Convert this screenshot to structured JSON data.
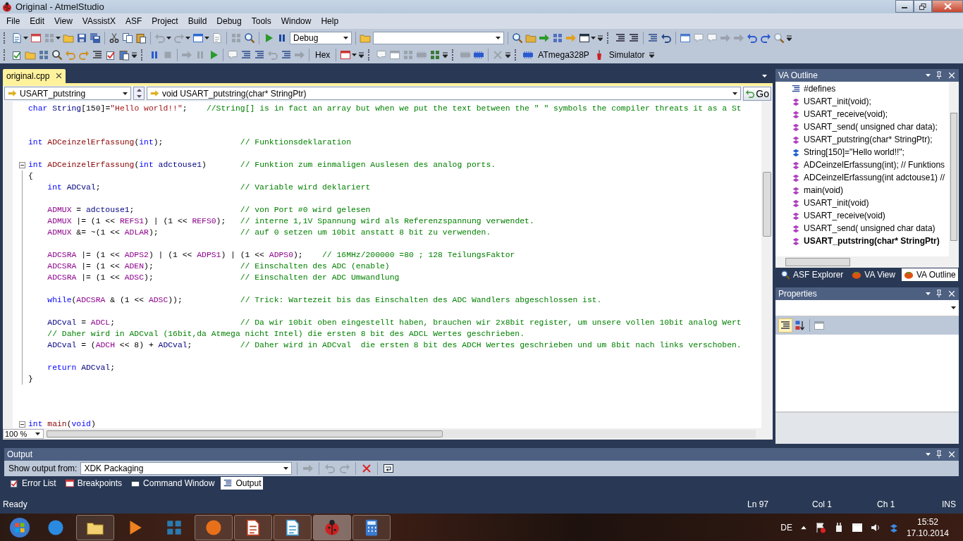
{
  "window": {
    "title": "Original - AtmelStudio"
  },
  "menu": [
    "File",
    "Edit",
    "View",
    "VAssistX",
    "ASF",
    "Project",
    "Build",
    "Debug",
    "Tools",
    "Window",
    "Help"
  ],
  "toolbar": {
    "configuration": "Debug",
    "hex_button": "Hex",
    "device": "ATmega328P",
    "debugger": "Simulator"
  },
  "editor": {
    "tab": {
      "label": "original.cpp"
    },
    "scope": "USART_putstring",
    "member": "void USART_putstring(char* StringPtr)",
    "go_button": "Go",
    "zoom": "100 %",
    "lines": [
      {
        "kind": "code",
        "foldable": false,
        "in_block": false,
        "indented": false,
        "tokens": [
          {
            "kind": "kw",
            "text": "char "
          },
          {
            "kind": "var",
            "text": "String"
          },
          {
            "kind": "plain",
            "text": "[150]="
          },
          {
            "kind": "str",
            "text": "\"Hello world!!\""
          },
          {
            "kind": "plain",
            "text": ";    "
          },
          {
            "kind": "comment",
            "text": "//String[] is in fact an array but when we put the text between the \" \" symbols the compiler threats it as a St"
          }
        ]
      },
      {
        "kind": "blank",
        "foldable": false,
        "in_block": false
      },
      {
        "kind": "blank",
        "foldable": false,
        "in_block": false
      },
      {
        "kind": "code",
        "foldable": false,
        "in_block": false,
        "indented": false,
        "tokens": [
          {
            "kind": "kw",
            "text": "int "
          },
          {
            "kind": "fn",
            "text": "ADCeinzelErfassung"
          },
          {
            "kind": "plain",
            "text": "("
          },
          {
            "kind": "kw",
            "text": "int"
          },
          {
            "kind": "plain",
            "text": ");                "
          },
          {
            "kind": "comment",
            "text": "// Funktionsdeklaration"
          }
        ]
      },
      {
        "kind": "blank",
        "foldable": false,
        "in_block": false
      },
      {
        "kind": "code",
        "foldable": true,
        "in_block": false,
        "indented": false,
        "tokens": [
          {
            "kind": "kw",
            "text": "int "
          },
          {
            "kind": "fn",
            "text": "ADCeinzelErfassung"
          },
          {
            "kind": "plain",
            "text": "("
          },
          {
            "kind": "kw",
            "text": "int "
          },
          {
            "kind": "var",
            "text": "adctouse1"
          },
          {
            "kind": "plain",
            "text": ")       "
          },
          {
            "kind": "comment",
            "text": "// Funktion zum einmaligen Auslesen des analog ports."
          }
        ]
      },
      {
        "kind": "code",
        "foldable": false,
        "in_block": true,
        "indented": false,
        "tokens": [
          {
            "kind": "plain",
            "text": "{"
          }
        ]
      },
      {
        "kind": "code",
        "foldable": false,
        "in_block": true,
        "indented": true,
        "tokens": [
          {
            "kind": "kw",
            "text": "int "
          },
          {
            "kind": "var",
            "text": "ADCval"
          },
          {
            "kind": "plain",
            "text": ";                             "
          },
          {
            "kind": "comment",
            "text": "// Variable wird deklariert"
          }
        ]
      },
      {
        "kind": "blank",
        "foldable": false,
        "in_block": true
      },
      {
        "kind": "code",
        "foldable": false,
        "in_block": true,
        "indented": true,
        "tokens": [
          {
            "kind": "macro",
            "text": "ADMUX"
          },
          {
            "kind": "plain",
            "text": " = "
          },
          {
            "kind": "var",
            "text": "adctouse1"
          },
          {
            "kind": "plain",
            "text": ";                      "
          },
          {
            "kind": "comment",
            "text": "// von Port #0 wird gelesen"
          }
        ]
      },
      {
        "kind": "code",
        "foldable": false,
        "in_block": true,
        "indented": true,
        "tokens": [
          {
            "kind": "macro",
            "text": "ADMUX"
          },
          {
            "kind": "plain",
            "text": " |= (1 << "
          },
          {
            "kind": "macro",
            "text": "REFS1"
          },
          {
            "kind": "plain",
            "text": ") | (1 << "
          },
          {
            "kind": "macro",
            "text": "REFS0"
          },
          {
            "kind": "plain",
            "text": ");   "
          },
          {
            "kind": "comment",
            "text": "// interne 1,1V Spannung wird als Referenzspannung verwendet."
          }
        ]
      },
      {
        "kind": "code",
        "foldable": false,
        "in_block": true,
        "indented": true,
        "tokens": [
          {
            "kind": "macro",
            "text": "ADMUX"
          },
          {
            "kind": "plain",
            "text": " &= ~(1 << "
          },
          {
            "kind": "macro",
            "text": "ADLAR"
          },
          {
            "kind": "plain",
            "text": ");                 "
          },
          {
            "kind": "comment",
            "text": "// auf 0 setzen um 10bit anstatt 8 bit zu verwenden."
          }
        ]
      },
      {
        "kind": "blank",
        "foldable": false,
        "in_block": true
      },
      {
        "kind": "code",
        "foldable": false,
        "in_block": true,
        "indented": true,
        "tokens": [
          {
            "kind": "macro",
            "text": "ADCSRA"
          },
          {
            "kind": "plain",
            "text": " |= (1 << "
          },
          {
            "kind": "macro",
            "text": "ADPS2"
          },
          {
            "kind": "plain",
            "text": ") | (1 << "
          },
          {
            "kind": "macro",
            "text": "ADPS1"
          },
          {
            "kind": "plain",
            "text": ") | (1 << "
          },
          {
            "kind": "macro",
            "text": "ADPS0"
          },
          {
            "kind": "plain",
            "text": ");    "
          },
          {
            "kind": "comment",
            "text": "// 16MHz/200000 =80 ; 128 TeilungsFaktor"
          }
        ]
      },
      {
        "kind": "code",
        "foldable": false,
        "in_block": true,
        "indented": true,
        "tokens": [
          {
            "kind": "macro",
            "text": "ADCSRA"
          },
          {
            "kind": "plain",
            "text": " |= (1 << "
          },
          {
            "kind": "macro",
            "text": "ADEN"
          },
          {
            "kind": "plain",
            "text": ");                  "
          },
          {
            "kind": "comment",
            "text": "// Einschalten des ADC (enable)"
          }
        ]
      },
      {
        "kind": "code",
        "foldable": false,
        "in_block": true,
        "indented": true,
        "tokens": [
          {
            "kind": "macro",
            "text": "ADCSRA"
          },
          {
            "kind": "plain",
            "text": " |= (1 << "
          },
          {
            "kind": "macro",
            "text": "ADSC"
          },
          {
            "kind": "plain",
            "text": ");                  "
          },
          {
            "kind": "comment",
            "text": "// Einschalten der ADC Umwandlung"
          }
        ]
      },
      {
        "kind": "blank",
        "foldable": false,
        "in_block": true
      },
      {
        "kind": "code",
        "foldable": false,
        "in_block": true,
        "indented": true,
        "tokens": [
          {
            "kind": "kw",
            "text": "while"
          },
          {
            "kind": "plain",
            "text": "("
          },
          {
            "kind": "macro",
            "text": "ADCSRA"
          },
          {
            "kind": "plain",
            "text": " & (1 << "
          },
          {
            "kind": "macro",
            "text": "ADSC"
          },
          {
            "kind": "plain",
            "text": "));            "
          },
          {
            "kind": "comment",
            "text": "// Trick: Wartezeit bis das Einschalten des ADC Wandlers abgeschlossen ist."
          }
        ]
      },
      {
        "kind": "blank",
        "foldable": false,
        "in_block": true
      },
      {
        "kind": "code",
        "foldable": false,
        "in_block": true,
        "indented": true,
        "tokens": [
          {
            "kind": "var",
            "text": "ADCval"
          },
          {
            "kind": "plain",
            "text": " = "
          },
          {
            "kind": "macro",
            "text": "ADCL"
          },
          {
            "kind": "plain",
            "text": ";                          "
          },
          {
            "kind": "comment",
            "text": "// Da wir 10bit oben eingestellt haben, brauchen wir 2x8bit register, um unsere vollen 10bit analog Wert"
          }
        ]
      },
      {
        "kind": "code",
        "foldable": false,
        "in_block": true,
        "indented": true,
        "tokens": [
          {
            "kind": "comment",
            "text": "// Daher wird in ADCval (16bit,da Atmega nicht Intel) die ersten 8 bit des ADCL Wertes geschrieben."
          }
        ]
      },
      {
        "kind": "code",
        "foldable": false,
        "in_block": true,
        "indented": true,
        "tokens": [
          {
            "kind": "var",
            "text": "ADCval"
          },
          {
            "kind": "plain",
            "text": " = ("
          },
          {
            "kind": "macro",
            "text": "ADCH"
          },
          {
            "kind": "plain",
            "text": " << 8) + "
          },
          {
            "kind": "var",
            "text": "ADCval"
          },
          {
            "kind": "plain",
            "text": ";          "
          },
          {
            "kind": "comment",
            "text": "// Daher wird in ADCval  die ersten 8 bit des ADCH Wertes geschrieben und um 8bit nach links verschoben."
          }
        ]
      },
      {
        "kind": "blank",
        "foldable": false,
        "in_block": true
      },
      {
        "kind": "code",
        "foldable": false,
        "in_block": true,
        "indented": true,
        "tokens": [
          {
            "kind": "kw",
            "text": "return "
          },
          {
            "kind": "var",
            "text": "ADCval"
          },
          {
            "kind": "plain",
            "text": ";"
          }
        ]
      },
      {
        "kind": "code",
        "foldable": false,
        "in_block": true,
        "indented": false,
        "tokens": [
          {
            "kind": "plain",
            "text": "}"
          }
        ]
      },
      {
        "kind": "blank",
        "foldable": false,
        "in_block": false
      },
      {
        "kind": "blank",
        "foldable": false,
        "in_block": false
      },
      {
        "kind": "blank",
        "foldable": false,
        "in_block": false
      },
      {
        "kind": "code",
        "foldable": true,
        "in_block": false,
        "indented": false,
        "tokens": [
          {
            "kind": "kw",
            "text": "int "
          },
          {
            "kind": "fn",
            "text": "main"
          },
          {
            "kind": "plain",
            "text": "("
          },
          {
            "kind": "kw",
            "text": "void"
          },
          {
            "kind": "plain",
            "text": ")"
          }
        ]
      }
    ]
  },
  "va_outline": {
    "title": "VA Outline",
    "items": [
      {
        "kind": "defines",
        "label": "#defines",
        "current": false
      },
      {
        "kind": "function",
        "label": "USART_init(void);",
        "current": false
      },
      {
        "kind": "function",
        "label": "USART_receive(void);",
        "current": false
      },
      {
        "kind": "function",
        "label": "USART_send( unsigned char data);",
        "current": false
      },
      {
        "kind": "function",
        "label": "USART_putstring(char* StringPtr);",
        "current": false
      },
      {
        "kind": "variable",
        "label": "String[150]=\"Hello world!!\";",
        "current": false
      },
      {
        "kind": "function",
        "label": "ADCeinzelErfassung(int); // Funktions",
        "current": false
      },
      {
        "kind": "function",
        "label": "ADCeinzelErfassung(int adctouse1) //",
        "current": false
      },
      {
        "kind": "function",
        "label": "main(void)",
        "current": false
      },
      {
        "kind": "function",
        "label": "USART_init(void)",
        "current": false
      },
      {
        "kind": "function",
        "label": "USART_receive(void)",
        "current": false
      },
      {
        "kind": "function",
        "label": "USART_send( unsigned char data)",
        "current": false
      },
      {
        "kind": "function",
        "label": "USART_putstring(char* StringPtr)",
        "current": true
      }
    ],
    "tabs": [
      {
        "kind": "explorer",
        "label": "ASF Explorer",
        "selected": false
      },
      {
        "kind": "view",
        "label": "VA View",
        "selected": false
      },
      {
        "kind": "outline",
        "label": "VA Outline",
        "selected": true
      }
    ]
  },
  "properties": {
    "title": "Properties"
  },
  "output": {
    "title": "Output",
    "source_label": "Show output from:",
    "source": "XDK Packaging",
    "tabs": [
      {
        "kind": "errors",
        "label": "Error List",
        "selected": false
      },
      {
        "kind": "breakpoints",
        "label": "Breakpoints",
        "selected": false
      },
      {
        "kind": "command",
        "label": "Command Window",
        "selected": false
      },
      {
        "kind": "output",
        "label": "Output",
        "selected": true
      }
    ]
  },
  "status_bar": {
    "message": "Ready",
    "line": "Ln 97",
    "column": "Col 1",
    "char": "Ch 1",
    "mode": "INS"
  },
  "taskbar": {
    "apps": [
      {
        "kind": "ie",
        "running": false,
        "selected": false
      },
      {
        "kind": "explorer",
        "running": true,
        "selected": false
      },
      {
        "kind": "media",
        "running": false,
        "selected": false
      },
      {
        "kind": "toolbox",
        "running": false,
        "selected": false
      },
      {
        "kind": "firefox",
        "running": true,
        "selected": false
      },
      {
        "kind": "filezilla",
        "running": true,
        "selected": false
      },
      {
        "kind": "notepad",
        "running": true,
        "selected": false
      },
      {
        "kind": "atmel",
        "running": true,
        "selected": true
      },
      {
        "kind": "calculator",
        "running": true,
        "selected": false
      }
    ],
    "language": "DE",
    "time": "15:52",
    "date": "17.10.2014"
  }
}
